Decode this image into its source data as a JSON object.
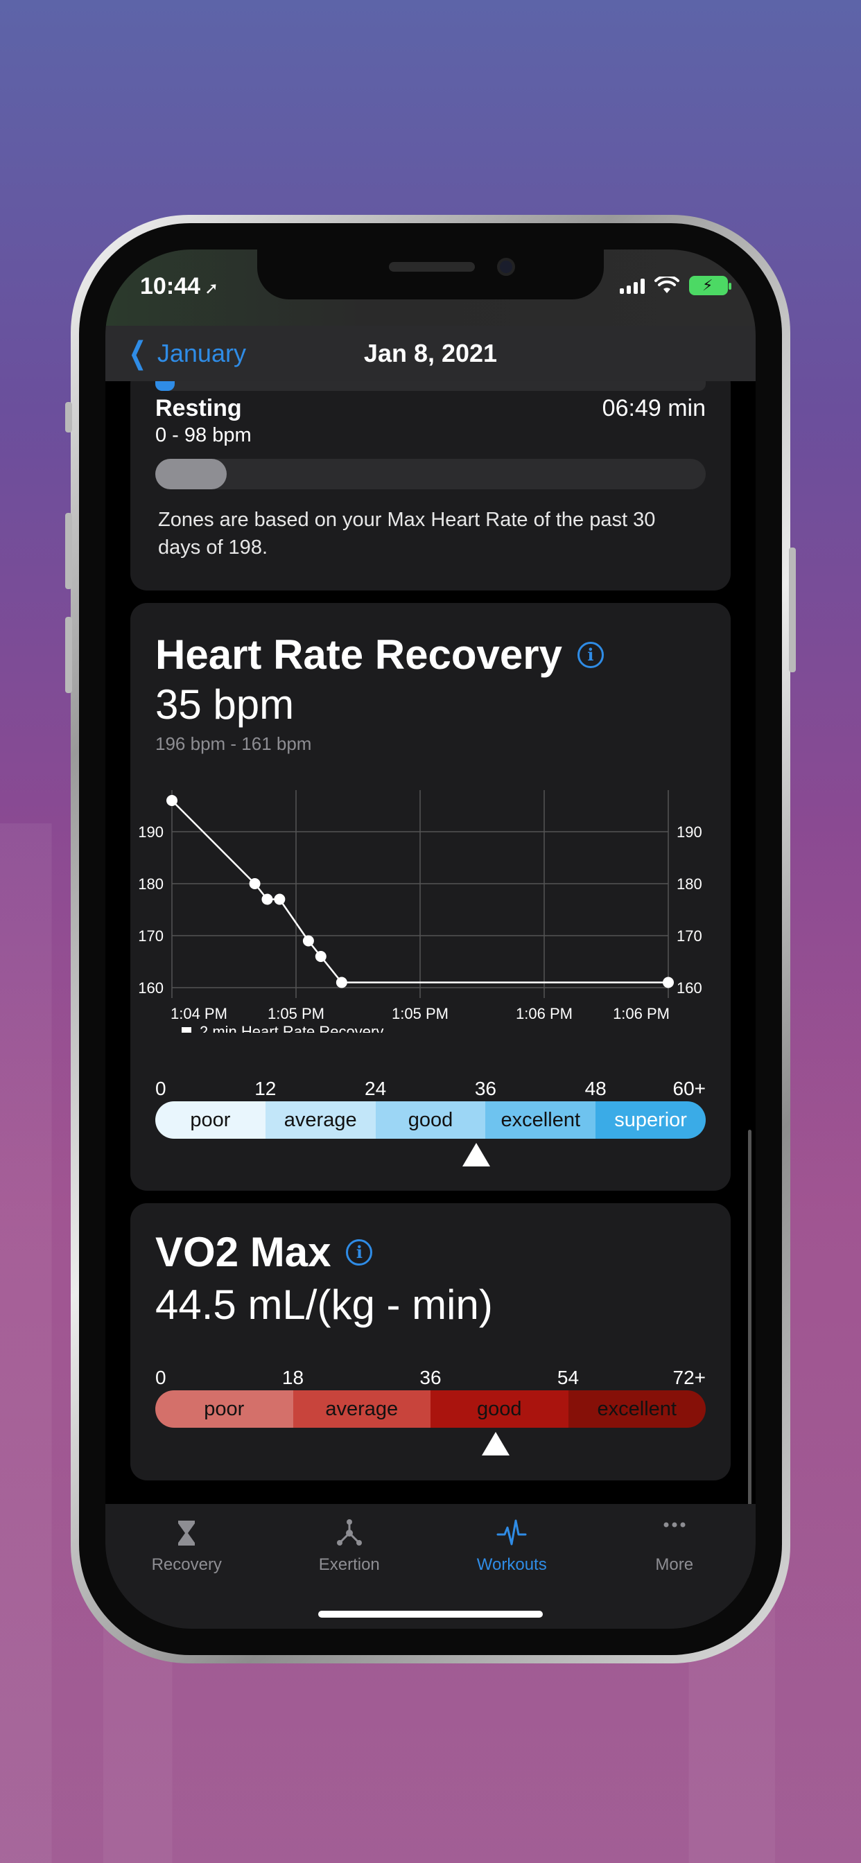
{
  "status": {
    "time": "10:44"
  },
  "nav": {
    "back_label": "January",
    "title": "Jan 8, 2021"
  },
  "zones": {
    "label": "Resting",
    "range": "0 - 98 bpm",
    "time": "06:49 min",
    "fill_fraction": 0.13,
    "note": "Zones are based on your Max Heart Rate of the past 30 days of 198."
  },
  "hrr": {
    "title": "Heart Rate Recovery",
    "value": "35 bpm",
    "range": "196 bpm - 161 bpm",
    "legend": "2 min Heart Rate Recovery",
    "scale": {
      "ticks": [
        "0",
        "12",
        "24",
        "36",
        "48",
        "60+"
      ],
      "segments": [
        "poor",
        "average",
        "good",
        "excellent",
        "superior"
      ],
      "colors": [
        "#e9f6fd",
        "#c2e6f9",
        "#9cd6f5",
        "#6ec3ef",
        "#3aabe7"
      ],
      "marker_value": 35,
      "max": 60
    }
  },
  "chart_data": {
    "type": "line",
    "x_labels": [
      "1:04 PM",
      "1:05 PM",
      "1:05 PM",
      "1:06 PM",
      "1:06 PM"
    ],
    "y_ticks": [
      160,
      170,
      180,
      190
    ],
    "ylim": [
      158,
      198
    ],
    "series": [
      {
        "name": "2 min Heart Rate Recovery",
        "points": [
          {
            "x": 0.0,
            "y": 196
          },
          {
            "x": 0.167,
            "y": 180
          },
          {
            "x": 0.192,
            "y": 177
          },
          {
            "x": 0.217,
            "y": 177
          },
          {
            "x": 0.275,
            "y": 169
          },
          {
            "x": 0.3,
            "y": 166
          },
          {
            "x": 0.342,
            "y": 161
          },
          {
            "x": 1.0,
            "y": 161
          }
        ]
      }
    ],
    "grid": true
  },
  "vo2": {
    "title": "VO2 Max",
    "value": "44.5 mL/(kg - min)",
    "scale": {
      "ticks": [
        "0",
        "18",
        "36",
        "54",
        "72+"
      ],
      "segments": [
        "poor",
        "average",
        "good",
        "excellent"
      ],
      "colors": [
        "#d4706a",
        "#c8443c",
        "#aa140e",
        "#861008"
      ],
      "marker_value": 44.5,
      "max": 72
    }
  },
  "tabs": [
    {
      "label": "Recovery",
      "icon": "hourglass-icon",
      "active": false
    },
    {
      "label": "Exertion",
      "icon": "molecule-icon",
      "active": false
    },
    {
      "label": "Workouts",
      "icon": "heartbeat-icon",
      "active": true
    },
    {
      "label": "More",
      "icon": "ellipsis-icon",
      "active": false
    }
  ]
}
